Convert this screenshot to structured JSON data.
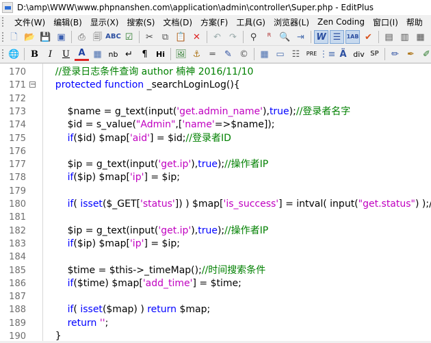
{
  "window": {
    "title": "D:\\amp\\WWW\\www.phpnanshen.com\\application\\admin\\controller\\Super.php - EditPlus"
  },
  "menu": [
    "文件(W)",
    "编辑(B)",
    "显示(X)",
    "搜索(S)",
    "文档(D)",
    "方案(F)",
    "工具(G)",
    "浏览器(L)",
    "Zen Coding",
    "窗口(I)",
    "帮助"
  ],
  "toolbar1": [
    "new-file",
    "open-folder",
    "save",
    "save-all",
    "print",
    "print-preview",
    "spell-check",
    "check",
    "cut",
    "copy",
    "paste",
    "delete",
    "undo",
    "redo",
    "find",
    "replace",
    "find-in-files",
    "goto",
    "indent",
    "word-wrap",
    "line-numbers",
    "code-folding",
    "checkmark",
    "panel-1",
    "panel-2",
    "panel-3",
    "panel-4"
  ],
  "toolbar2": [
    "browser",
    "bold",
    "italic",
    "underline",
    "font-color",
    "table",
    "nb",
    "br",
    "paragraph",
    "heading",
    "image",
    "anchor",
    "hr",
    "link",
    "comment",
    "table-2",
    "form",
    "list",
    "pre",
    "special-char",
    "insert",
    "div",
    "span",
    "edit",
    "pen",
    "pencil"
  ],
  "toolbar2_labels": {
    "bold": "B",
    "italic": "I",
    "underline": "U",
    "font_color": "A",
    "nb": "nb",
    "br": "↵",
    "paragraph": "¶",
    "heading": "Hi",
    "pre": "PRE",
    "div": "div",
    "span": "SP",
    "insert": "Ä"
  },
  "code_lines": [
    {
      "num": "170",
      "parts": [
        [
          "c",
          "    //登录日志条件查询 author 楠神 2016/11/10"
        ]
      ]
    },
    {
      "num": "171",
      "fold": "⊟",
      "parts": [
        [
          "k",
          "    protected function "
        ],
        [
          "",
          "_searchLoginLog(){"
        ]
      ]
    },
    {
      "num": "172",
      "parts": []
    },
    {
      "num": "173",
      "parts": [
        [
          "",
          "        $name = g_text(input("
        ],
        [
          "s",
          "'get.admin_name'"
        ],
        [
          "",
          "),"
        ],
        [
          "k",
          "true"
        ],
        [
          "",
          ");"
        ],
        [
          "c",
          "//登录者名字"
        ]
      ]
    },
    {
      "num": "174",
      "parts": [
        [
          "",
          "        $id = s_value("
        ],
        [
          "s",
          "\"Admin\""
        ],
        [
          "",
          ",["
        ],
        [
          "s",
          "'name'"
        ],
        [
          "",
          "=>$name]);"
        ]
      ]
    },
    {
      "num": "175",
      "parts": [
        [
          "k",
          "        if"
        ],
        [
          "",
          "($id) $map["
        ],
        [
          "s",
          "'aid'"
        ],
        [
          "",
          "] = $id;"
        ],
        [
          "c",
          "//登录者ID"
        ]
      ]
    },
    {
      "num": "176",
      "parts": []
    },
    {
      "num": "177",
      "parts": [
        [
          "",
          "        $ip = g_text(input("
        ],
        [
          "s",
          "'get.ip'"
        ],
        [
          "",
          "),"
        ],
        [
          "k",
          "true"
        ],
        [
          "",
          ");"
        ],
        [
          "c",
          "//操作者IP"
        ]
      ]
    },
    {
      "num": "178",
      "parts": [
        [
          "k",
          "        if"
        ],
        [
          "",
          "($ip) $map["
        ],
        [
          "s",
          "'ip'"
        ],
        [
          "",
          "] = $ip;"
        ]
      ]
    },
    {
      "num": "179",
      "parts": []
    },
    {
      "num": "180",
      "parts": [
        [
          "k",
          "        if"
        ],
        [
          "",
          "( "
        ],
        [
          "k",
          "isset"
        ],
        [
          "",
          "($_GET["
        ],
        [
          "s",
          "'status'"
        ],
        [
          "",
          "]) ) $map["
        ],
        [
          "s",
          "'is_success'"
        ],
        [
          "",
          "] = intval( input("
        ],
        [
          "s",
          "\"get.status\""
        ],
        [
          "",
          ") );/"
        ]
      ]
    },
    {
      "num": "181",
      "parts": []
    },
    {
      "num": "182",
      "parts": [
        [
          "",
          "        $ip = g_text(input("
        ],
        [
          "s",
          "'get.ip'"
        ],
        [
          "",
          "),"
        ],
        [
          "k",
          "true"
        ],
        [
          "",
          ");"
        ],
        [
          "c",
          "//操作者IP"
        ]
      ]
    },
    {
      "num": "183",
      "parts": [
        [
          "k",
          "        if"
        ],
        [
          "",
          "($ip) $map["
        ],
        [
          "s",
          "'ip'"
        ],
        [
          "",
          "] = $ip;"
        ]
      ]
    },
    {
      "num": "184",
      "parts": []
    },
    {
      "num": "185",
      "parts": [
        [
          "",
          "        $time = $this->_timeMap();"
        ],
        [
          "c",
          "//时间搜索条件"
        ]
      ]
    },
    {
      "num": "186",
      "parts": [
        [
          "k",
          "        if"
        ],
        [
          "",
          "($time) $map["
        ],
        [
          "s",
          "'add_time'"
        ],
        [
          "",
          "] = $time;"
        ]
      ]
    },
    {
      "num": "187",
      "parts": []
    },
    {
      "num": "188",
      "parts": [
        [
          "k",
          "        if"
        ],
        [
          "",
          "( "
        ],
        [
          "k",
          "isset"
        ],
        [
          "",
          "($map) ) "
        ],
        [
          "k",
          "return"
        ],
        [
          "",
          " $map;"
        ]
      ]
    },
    {
      "num": "189",
      "parts": [
        [
          "k",
          "        return"
        ],
        [
          "",
          " "
        ],
        [
          "s",
          "''"
        ],
        [
          "",
          ";"
        ]
      ]
    },
    {
      "num": "190",
      "parts": [
        [
          "",
          "    }"
        ]
      ]
    }
  ],
  "colors": {
    "keyword": "#0000ff",
    "comment": "#008000",
    "string": "#c000c0"
  }
}
